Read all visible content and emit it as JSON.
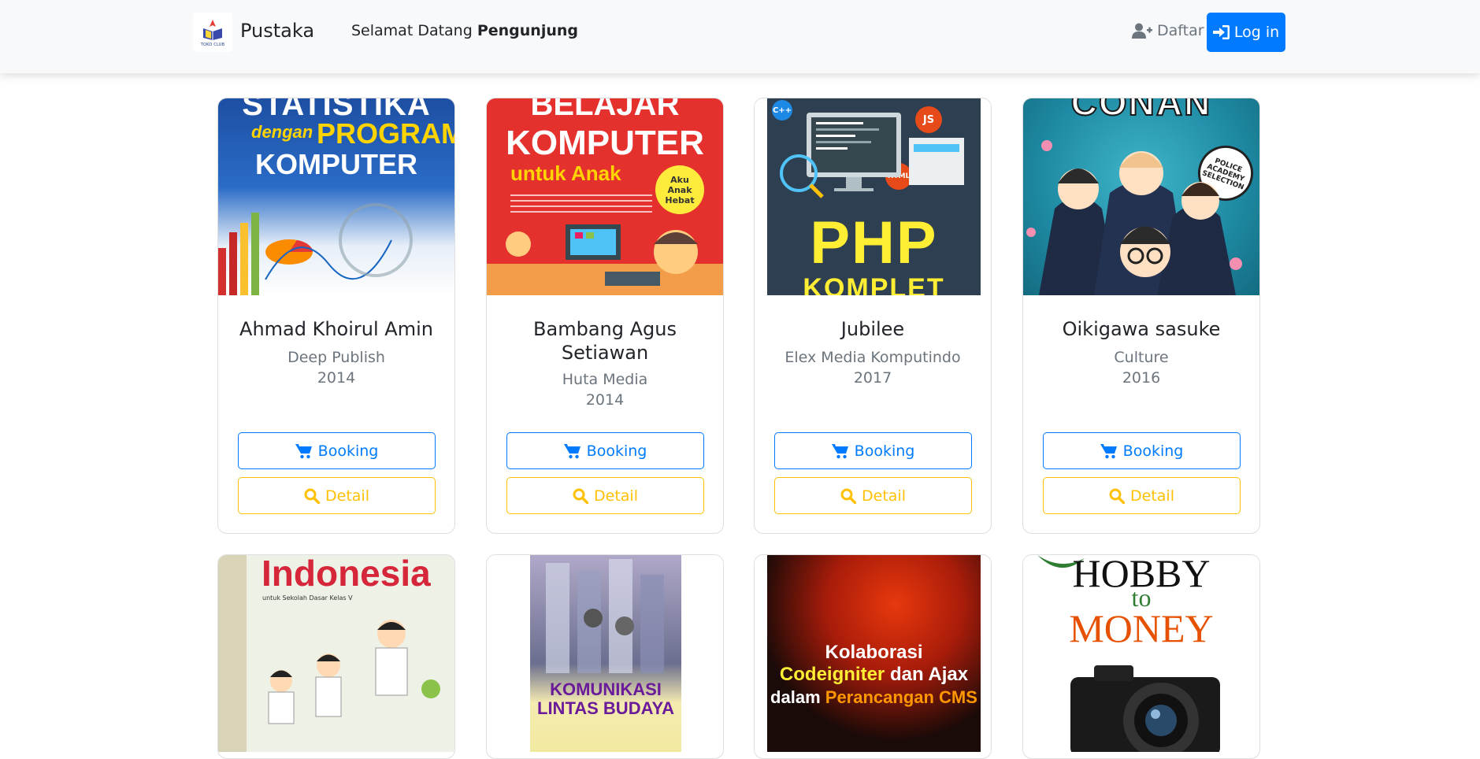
{
  "nav": {
    "brand": "Pustaka",
    "logo_text": "TOKO CLUB",
    "welcome_prefix": "Selamat Datang ",
    "welcome_user": "Pengunjung",
    "register_label": "Daftar",
    "login_label": "Log in"
  },
  "buttons": {
    "booking": "Booking",
    "detail": "Detail"
  },
  "books": [
    {
      "author": "Ahmad Khoirul Amin",
      "publisher": "Deep Publish",
      "year": "2014",
      "cover_lines": [
        "STATISTIKA",
        "dengan",
        "PROGRAM",
        "KOMPUTER"
      ]
    },
    {
      "author": "Bambang Agus Setiawan",
      "publisher": "Huta Media",
      "year": "2014",
      "cover_lines": [
        "BELAJAR",
        "KOMPUTER",
        "untuk Anak",
        "Aku Anak Hebat"
      ]
    },
    {
      "author": "Jubilee",
      "publisher": "Elex Media Komputindo",
      "year": "2017",
      "cover_lines": [
        "C++",
        "JS",
        "HTML",
        "PHP",
        "KOMPLET"
      ]
    },
    {
      "author": "Oikigawa sasuke",
      "publisher": "Culture",
      "year": "2016",
      "cover_lines": [
        "CONAN",
        "POLICE ACADEMY SELECTION"
      ]
    },
    {
      "cover_lines": [
        "Indonesia",
        "untuk Sekolah Dasar Kelas V"
      ]
    },
    {
      "cover_lines": [
        "KOMUNIKASI",
        "LINTAS BUDAYA"
      ]
    },
    {
      "cover_lines": [
        "Kolaborasi",
        "Codeigniter",
        "dan Ajax",
        "dalam",
        "Perancangan CMS"
      ]
    },
    {
      "cover_lines": [
        "HOBBY",
        "to",
        "MONEY"
      ]
    }
  ],
  "colors": {
    "primary": "#007bff",
    "warning": "#ffc107",
    "muted": "#6c757d"
  },
  "icons": {
    "register": "user-plus-icon",
    "login": "sign-in-icon",
    "booking": "cart-icon",
    "detail": "search-icon"
  }
}
